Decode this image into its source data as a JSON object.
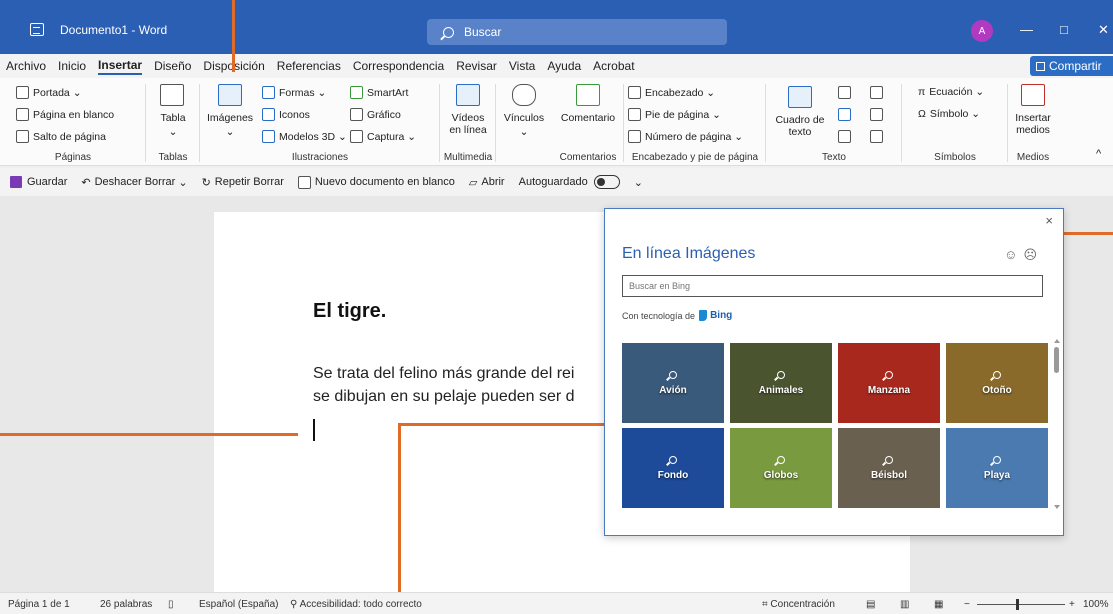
{
  "title_bar": {
    "doc_title": "Documento1 - Word",
    "search_placeholder": "Buscar",
    "avatar_initial": "A",
    "minimize": "—",
    "maximize": "□",
    "close": "✕"
  },
  "menu": {
    "tabs": [
      "Archivo",
      "Inicio",
      "Insertar",
      "Diseño",
      "Disposición",
      "Referencias",
      "Correspondencia",
      "Revisar",
      "Vista",
      "Ayuda",
      "Acrobat"
    ],
    "active_tab": "Insertar",
    "share_label": "Compartir"
  },
  "ribbon": {
    "paginas": {
      "label": "Páginas",
      "items": [
        "Portada",
        "Página en blanco",
        "Salto de página"
      ]
    },
    "tablas": {
      "label": "Tablas",
      "tabla": "Tabla"
    },
    "ilustraciones": {
      "label": "Ilustraciones",
      "imagenes": "Imágenes",
      "formas": "Formas",
      "iconos": "Iconos",
      "modelos3d": "Modelos 3D",
      "smartart": "SmartArt",
      "grafico": "Gráfico",
      "captura": "Captura"
    },
    "multimedia": {
      "label": "Multimedia",
      "videos_line1": "Vídeos",
      "videos_line2": "en línea"
    },
    "vinculos": {
      "label": "Vínculos"
    },
    "comentarios": {
      "label": "Comentarios",
      "comentario": "Comentario"
    },
    "encabezado": {
      "label": "Encabezado y pie de página",
      "items": [
        "Encabezado",
        "Pie de página",
        "Número de página"
      ]
    },
    "texto": {
      "label": "Texto",
      "cuadro_line1": "Cuadro de",
      "cuadro_line2": "texto"
    },
    "simbolos": {
      "label": "Símbolos",
      "ecuacion": "Ecuación",
      "simbolo": "Símbolo"
    },
    "medios": {
      "label": "Medios",
      "insertar_line1": "Insertar",
      "insertar_line2": "medios"
    }
  },
  "quick_access": {
    "guardar": "Guardar",
    "deshacer": "Deshacer Borrar",
    "repetir": "Repetir Borrar",
    "nuevo": "Nuevo documento en blanco",
    "abrir": "Abrir",
    "autoguardado": "Autoguardado"
  },
  "document": {
    "heading": "El tigre.",
    "line1": "Se trata del felino más grande del rei",
    "line2": "se dibujan en su pelaje pueden ser d"
  },
  "online_images": {
    "title": "En línea Imágenes",
    "search_placeholder": "Buscar en Bing",
    "powered_by": "Con tecnología de",
    "bing": "Bing",
    "close": "×",
    "tiles": [
      {
        "label": "Avión",
        "color": "#3a5a7c"
      },
      {
        "label": "Animales",
        "color": "#4a5530"
      },
      {
        "label": "Manzana",
        "color": "#a8281e"
      },
      {
        "label": "Otoño",
        "color": "#8a6a2a"
      },
      {
        "label": "Fondo",
        "color": "#1e4a9a"
      },
      {
        "label": "Globos",
        "color": "#7a9a40"
      },
      {
        "label": "Béisbol",
        "color": "#6a6050"
      },
      {
        "label": "Playa",
        "color": "#4a7ab0"
      }
    ]
  },
  "status": {
    "page": "Página 1 de 1",
    "words": "26 palabras",
    "language": "Español (España)",
    "accessibility": "Accesibilidad: todo correcto",
    "focus": "Concentración",
    "zoom": "100%"
  },
  "colors": {
    "title_bar": "#2b5fb4",
    "accent_orange": "#e06a28"
  }
}
